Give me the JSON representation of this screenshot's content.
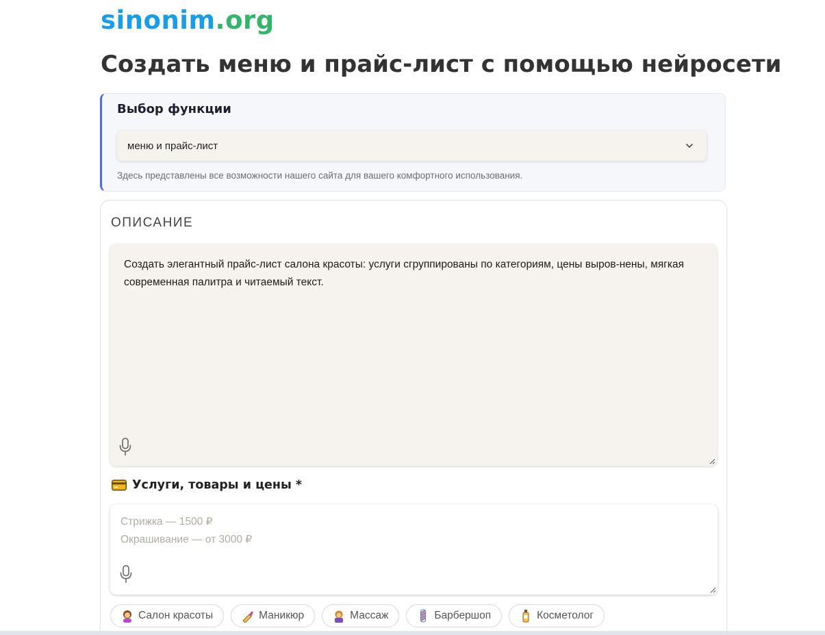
{
  "logo": {
    "part1": "sinonim",
    "part2": ".org"
  },
  "page_title": "Создать меню и прайс-лист с помощью нейросети",
  "function_select": {
    "title": "Выбор функции",
    "selected": "меню и прайс-лист",
    "hint": "Здесь представлены все возможности нашего сайта для вашего комфортного использования."
  },
  "description": {
    "label": "ОПИСАНИЕ",
    "text": "Создать элегантный прайс-лист салона красоты: услуги сгруппированы по категориям, цены выров-нены, мягкая современная палитра и читаемый текст."
  },
  "prices": {
    "label": "Услуги, товары и цены *",
    "placeholder_line1": "Стрижка — 1500 ₽",
    "placeholder_line2": "Окрашивание — от 3000 ₽"
  },
  "chips": [
    {
      "label": "Салон красоты",
      "icon": "hairdresser-icon"
    },
    {
      "label": "Маникюр",
      "icon": "nail-polish-icon"
    },
    {
      "label": "Массаж",
      "icon": "massage-icon"
    },
    {
      "label": "Барбершоп",
      "icon": "barber-pole-icon"
    },
    {
      "label": "Косметолог",
      "icon": "lotion-bottle-icon"
    }
  ],
  "colors": {
    "logo_blue": "#1a9de6",
    "logo_green": "#35b46b",
    "accent_border": "#4a6fdc",
    "input_bg": "#f6f3ee"
  }
}
